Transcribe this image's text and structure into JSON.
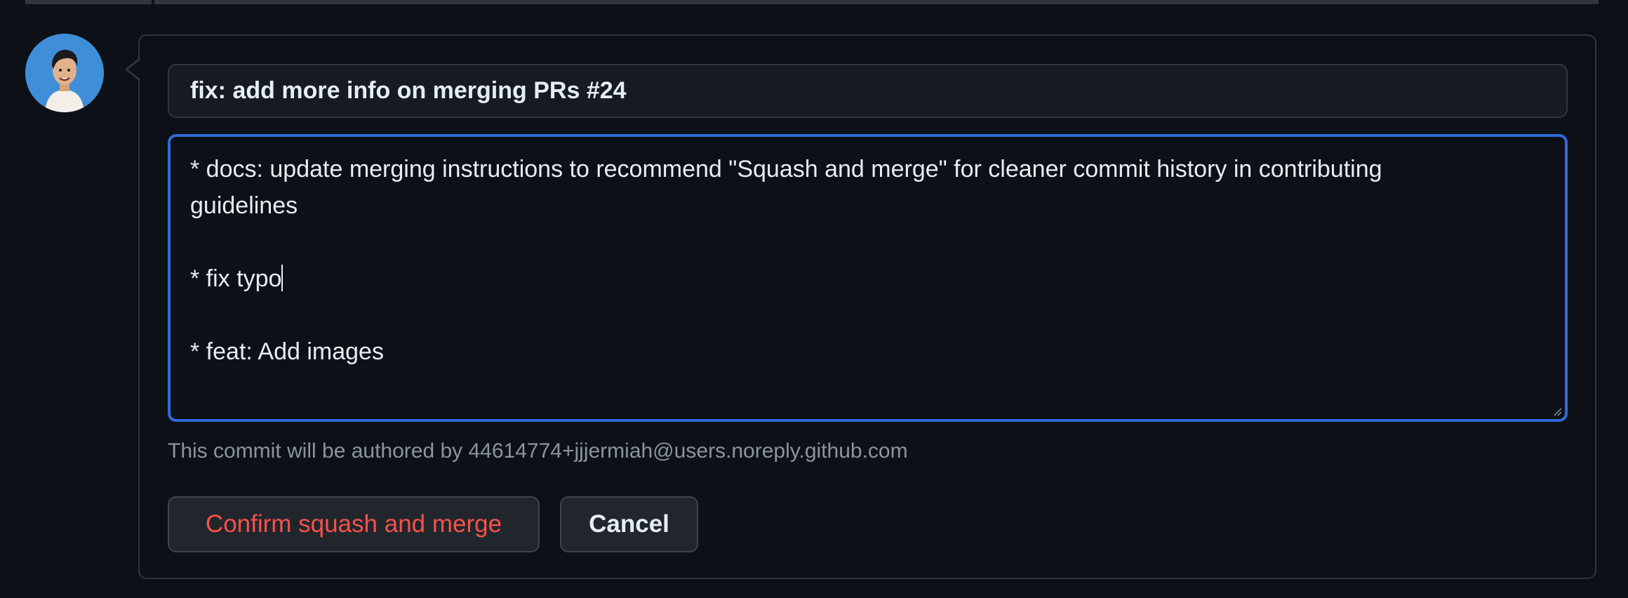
{
  "commit_title": "fix: add more info on merging PRs #24",
  "commit_message_lines": [
    "* docs: update merging instructions to recommend \"Squash and merge\" for cleaner commit history in contributing",
    "guidelines",
    "",
    "* fix typo",
    "",
    "* feat: Add images"
  ],
  "author_note": "This commit will be authored by 44614774+jjjermiah@users.noreply.github.com",
  "buttons": {
    "confirm_label": "Confirm squash and merge",
    "cancel_label": "Cancel"
  },
  "colors": {
    "background": "#0d1117",
    "focus_border": "#2f6bd9",
    "danger_text": "#f85149",
    "avatar_bg": "#3f8fd8"
  },
  "icons": {
    "avatar": "user-avatar-icon",
    "resize": "resize-grip-icon"
  }
}
